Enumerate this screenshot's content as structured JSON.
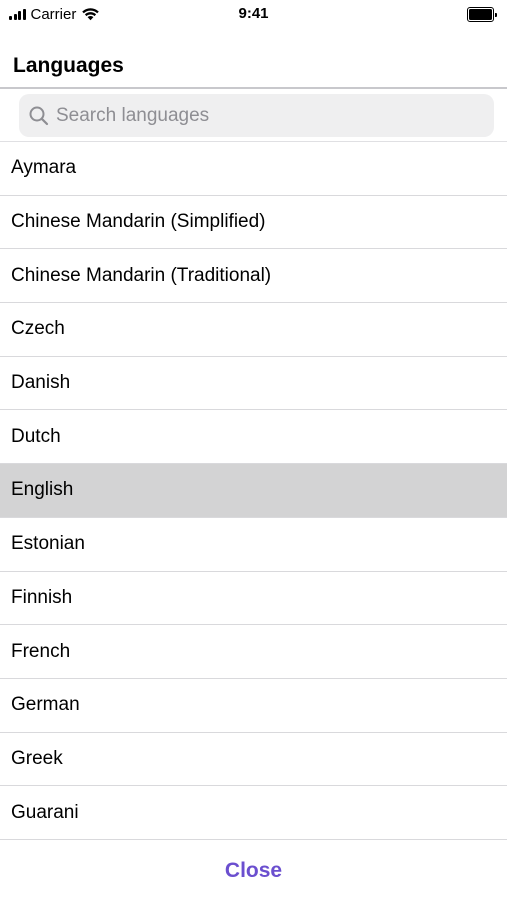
{
  "status_bar": {
    "carrier": "Carrier",
    "time": "9:41",
    "icons": [
      "signal-icon",
      "wifi-icon",
      "battery-icon"
    ]
  },
  "header": {
    "title": "Languages"
  },
  "search": {
    "placeholder": "Search languages",
    "icon": "search-icon"
  },
  "languages": [
    {
      "label": "Aymara",
      "selected": false
    },
    {
      "label": "Chinese Mandarin (Simplified)",
      "selected": false
    },
    {
      "label": "Chinese Mandarin (Traditional)",
      "selected": false
    },
    {
      "label": "Czech",
      "selected": false
    },
    {
      "label": "Danish",
      "selected": false
    },
    {
      "label": "Dutch",
      "selected": false
    },
    {
      "label": "English",
      "selected": true
    },
    {
      "label": "Estonian",
      "selected": false
    },
    {
      "label": "Finnish",
      "selected": false
    },
    {
      "label": "French",
      "selected": false
    },
    {
      "label": "German",
      "selected": false
    },
    {
      "label": "Greek",
      "selected": false
    },
    {
      "label": "Guarani",
      "selected": false
    }
  ],
  "footer": {
    "close_label": "Close"
  },
  "colors": {
    "accent": "#6b4fcf",
    "selected_row": "#d3d3d4",
    "search_bg": "#efeff0",
    "placeholder": "#8e8e93"
  }
}
